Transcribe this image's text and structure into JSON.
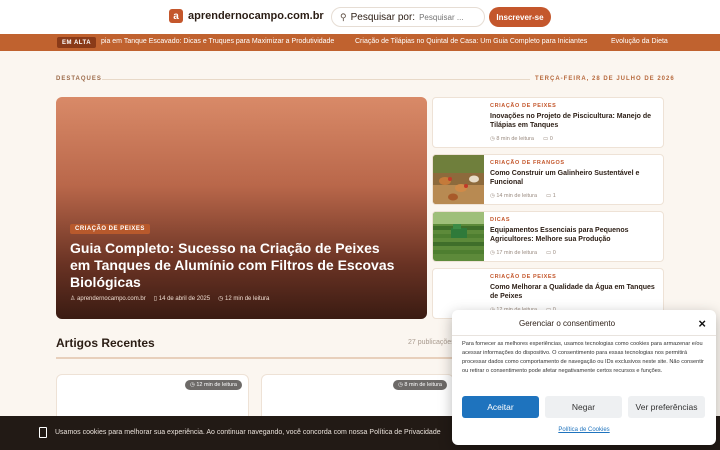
{
  "header": {
    "logo_mark": "a",
    "logo_text": "aprendernocampo.com.br",
    "search_label": "Pesquisar por:",
    "search_placeholder": "Pesquisar ...",
    "subscribe_label": "Inscrever-se"
  },
  "ticker": {
    "label": "EM ALTA",
    "items": [
      "pia em Tanque Escavado: Dicas e Truques para Maximizar a Produtividade",
      "Criação de Tilápias no Quintal de Casa: Um Guia Completo para Iniciantes",
      "Evolução da Dieta"
    ]
  },
  "highlights": {
    "label": "DESTAQUES",
    "date": "TERÇA-FEIRA, 28 DE JULHO DE 2026"
  },
  "hero": {
    "category": "CRIAÇÃO DE PEIXES",
    "title": "Guia Completo: Sucesso na Criação de Peixes em Tanques de Alumínio com Filtros de Escovas Biológicas",
    "site": "aprendernocampo.com.br",
    "date": "14 de abril de 2025",
    "read_time": "12 min de leitura"
  },
  "side_cards": [
    {
      "category": "CRIAÇÃO DE PEIXES",
      "title": "Inovações no Projeto de Piscicultura: Manejo de Tilápias em Tanques",
      "read_time": "8 min de leitura",
      "comments": "0",
      "thumb": "none"
    },
    {
      "category": "CRIAÇÃO DE FRANGOS",
      "title": "Como Construir um Galinheiro Sustentável e Funcional",
      "read_time": "14 min de leitura",
      "comments": "1",
      "thumb": "chickens"
    },
    {
      "category": "DICAS",
      "title": "Equipamentos Essenciais para Pequenos Agricultores: Melhore sua Produção",
      "read_time": "17 min de leitura",
      "comments": "0",
      "thumb": "field"
    },
    {
      "category": "CRIAÇÃO DE PEIXES",
      "title": "Como Melhorar a Qualidade da Água em Tanques de Peixes",
      "read_time": "12 min de leitura",
      "comments": "0",
      "thumb": "none"
    }
  ],
  "recent": {
    "title": "Artigos Recentes",
    "count": "27 publicações",
    "cards": [
      {
        "read_time": "12 min de leitura"
      },
      {
        "read_time": "8 min de leitura"
      }
    ]
  },
  "cookie_bar": {
    "text": "Usamos cookies para melhorar sua experiência. Ao continuar navegando, você concorda com nossa Política de Privacidade"
  },
  "consent": {
    "title": "Gerenciar o consentimento",
    "close_icon": "×",
    "body": "Para fornecer as melhores experiências, usamos tecnologias como cookies para armazenar e/ou acessar informações do dispositivo. O consentimento para essas tecnologias nos permitirá processar dados como comportamento de navegação ou IDs exclusivos neste site. Não consentir ou retirar o consentimento pode afetar negativamente certos recursos e funções.",
    "accept_label": "Aceitar",
    "deny_label": "Negar",
    "prefs_label": "Ver preferências",
    "policy_link": "Política de Cookies"
  },
  "colors": {
    "brand": "#c4572c",
    "ticker_bg": "#c0622f",
    "accept": "#1e73be",
    "page_bg": "#fbf6f0"
  }
}
